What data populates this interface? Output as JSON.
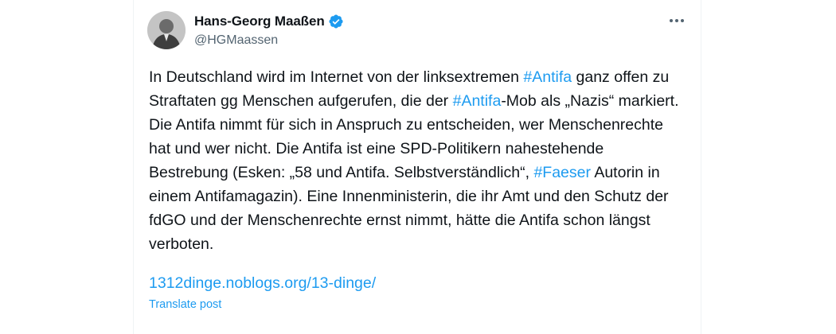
{
  "author": {
    "display_name": "Hans-Georg Maaßen",
    "handle": "@HGMaassen",
    "verified": true
  },
  "icons": {
    "verified": "verified-badge-icon",
    "more": "more-horizontal-icon"
  },
  "tweet": {
    "segments": [
      {
        "type": "text",
        "text": "In Deutschland wird im Internet von der linksextremen "
      },
      {
        "type": "hashtag",
        "text": "#Antifa"
      },
      {
        "type": "text",
        "text": " ganz offen zu Straftaten gg Menschen aufgerufen, die der "
      },
      {
        "type": "hashtag",
        "text": "#Antifa"
      },
      {
        "type": "text",
        "text": "-Mob als „Nazis“ markiert. Die Antifa nimmt für sich in Anspruch zu entscheiden, wer Menschenrechte hat und wer nicht. Die Antifa ist eine SPD-Politikern nahestehende Bestrebung (Esken: „58 und Antifa. Selbstverständlich“, "
      },
      {
        "type": "hashtag",
        "text": "#Faeser"
      },
      {
        "type": "text",
        "text": " Autorin in einem Antifamagazin). Eine Innenministerin, die ihr Amt und den Schutz der fdGO und der Menschenrechte ernst nimmt, hätte die Antifa schon längst verboten."
      }
    ],
    "link": "1312dinge.noblogs.org/13-dinge/",
    "translate_label": "Translate post"
  },
  "colors": {
    "accent": "#1d9bf0",
    "text": "#0f1419",
    "secondary": "#536471"
  }
}
